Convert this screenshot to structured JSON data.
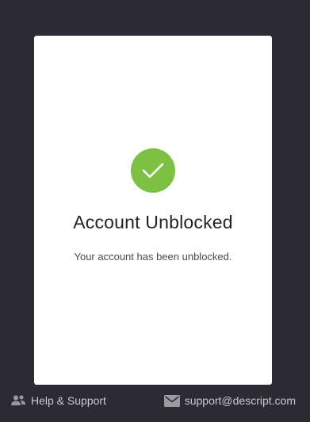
{
  "colors": {
    "background": "#2b2c33",
    "card": "#ffffff",
    "success": "#7dc142",
    "footer_text": "#c9cace"
  },
  "status": {
    "icon": "checkmark-icon",
    "title": "Account Unblocked",
    "message": "Your account has been unblocked."
  },
  "footer": {
    "help": {
      "icon": "people-icon",
      "label": "Help & Support"
    },
    "email": {
      "icon": "envelope-icon",
      "label": "support@descript.com"
    }
  }
}
